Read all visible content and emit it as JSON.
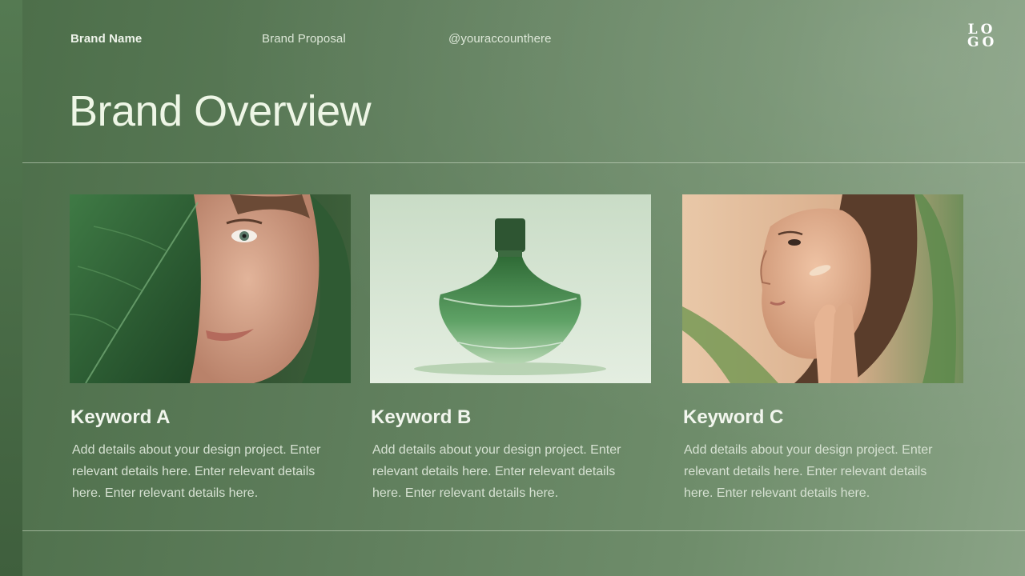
{
  "header": {
    "brand_name": "Brand Name",
    "proposal": "Brand Proposal",
    "account": "@youraccounthere",
    "logo_line1": "LO",
    "logo_line2": "GO"
  },
  "title": "Brand Overview",
  "cards": [
    {
      "title": "Keyword A",
      "text": "Add details about your design project. Enter relevant details here. Enter relevant details here. Enter relevant details here."
    },
    {
      "title": "Keyword B",
      "text": "Add details about your design project. Enter relevant details here. Enter relevant details here. Enter relevant details here."
    },
    {
      "title": "Keyword C",
      "text": "Add details about your design project. Enter relevant details here. Enter relevant details here. Enter relevant details here."
    }
  ],
  "colors": {
    "background_dark": "#4c6e49",
    "background_light": "#8aa386",
    "text_primary": "#eef6e6"
  }
}
